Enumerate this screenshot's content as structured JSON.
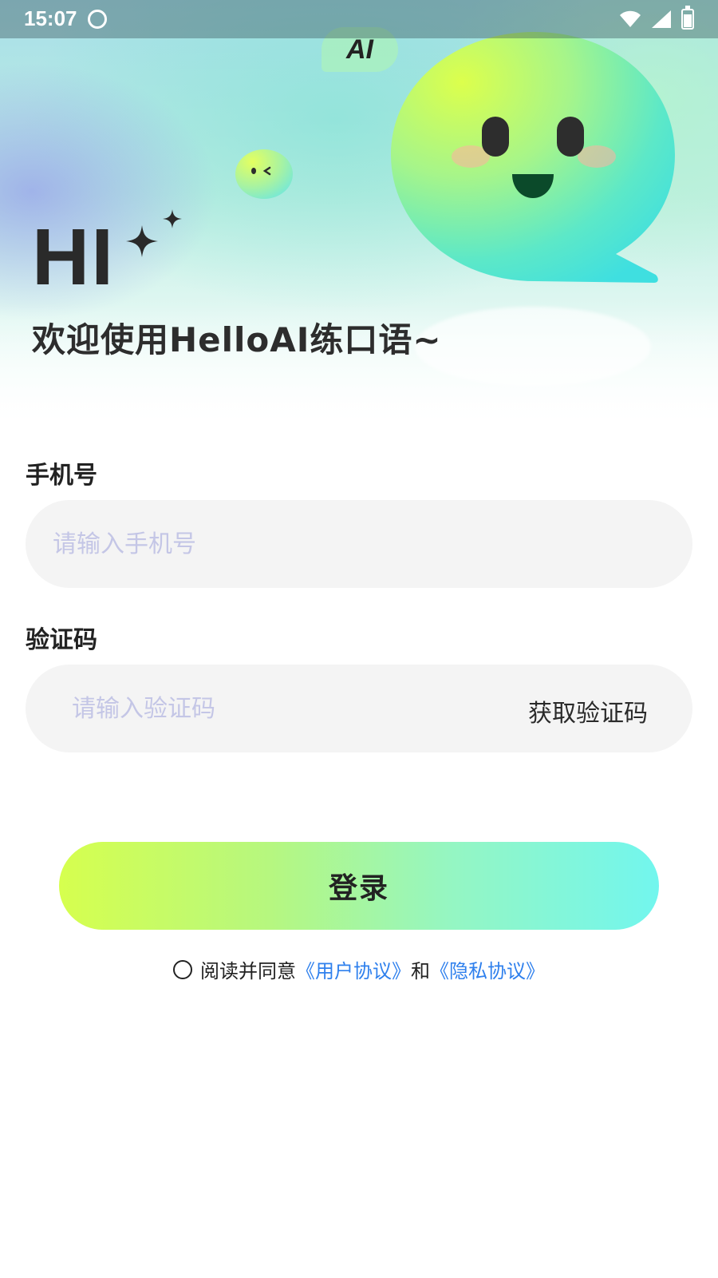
{
  "status_bar": {
    "time": "15:07"
  },
  "hero": {
    "ai_badge": "AI",
    "greeting": "HI",
    "welcome": "欢迎使用HelloAI练口语~"
  },
  "form": {
    "phone": {
      "label": "手机号",
      "placeholder": "请输入手机号",
      "value": ""
    },
    "code": {
      "label": "验证码",
      "placeholder": "请输入验证码",
      "value": "",
      "get_code_label": "获取验证码"
    },
    "login_label": "登录"
  },
  "agreement": {
    "prefix": "阅读并同意",
    "user_agreement": "《用户协议》",
    "conjunction": "和",
    "privacy_agreement": "《隐私协议》",
    "checked": false
  },
  "colors": {
    "link": "#2f80ed",
    "placeholder": "#c4c6e6",
    "input_bg": "#f4f4f4",
    "button_gradient": [
      "#d6ff4e",
      "#72f6ee"
    ]
  }
}
